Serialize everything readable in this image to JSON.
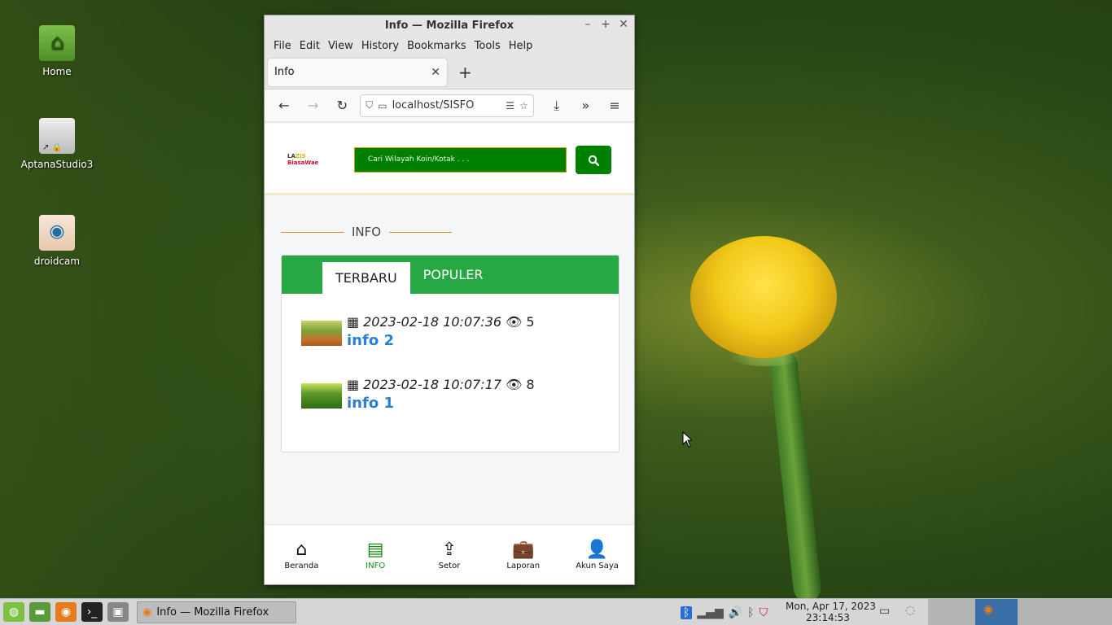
{
  "desktop": {
    "icons": [
      {
        "label": "Home",
        "icon": "folder-home-icon"
      },
      {
        "label": "AptanaStudio3",
        "icon": "aptana-icon"
      },
      {
        "label": "droidcam",
        "icon": "droidcam-eye-icon"
      }
    ]
  },
  "window": {
    "title": "Info — Mozilla Firefox",
    "menu": [
      "File",
      "Edit",
      "View",
      "History",
      "Bookmarks",
      "Tools",
      "Help"
    ],
    "tab_title": "Info",
    "url": "localhost/SISFO"
  },
  "site": {
    "logo_line1_prefix": "LA",
    "logo_line1_highlight": "ZIS",
    "logo_line2": "BiasaWae",
    "search_placeholder": "Cari Wilayah Koin/Kotak . . .",
    "section_title": "INFO",
    "tabs": [
      {
        "label": "TERBARU",
        "active": true
      },
      {
        "label": "POPULER",
        "active": false
      }
    ],
    "posts": [
      {
        "date": "2023-02-18 10:07:36",
        "views": "5",
        "title": "info 2"
      },
      {
        "date": "2023-02-18 10:07:17",
        "views": "8",
        "title": "info 1"
      }
    ],
    "bottom_nav": [
      {
        "label": "Beranda",
        "icon": "home-icon"
      },
      {
        "label": "INFO",
        "icon": "newspaper-icon",
        "active": true
      },
      {
        "label": "Setor",
        "icon": "upload-icon"
      },
      {
        "label": "Laporan",
        "icon": "briefcase-icon"
      },
      {
        "label": "Akun Saya",
        "icon": "user-icon"
      }
    ]
  },
  "taskbar": {
    "task_label": "Info — Mozilla Firefox",
    "clock_date": "Mon, Apr 17, 2023",
    "clock_time": "23:14:53"
  }
}
